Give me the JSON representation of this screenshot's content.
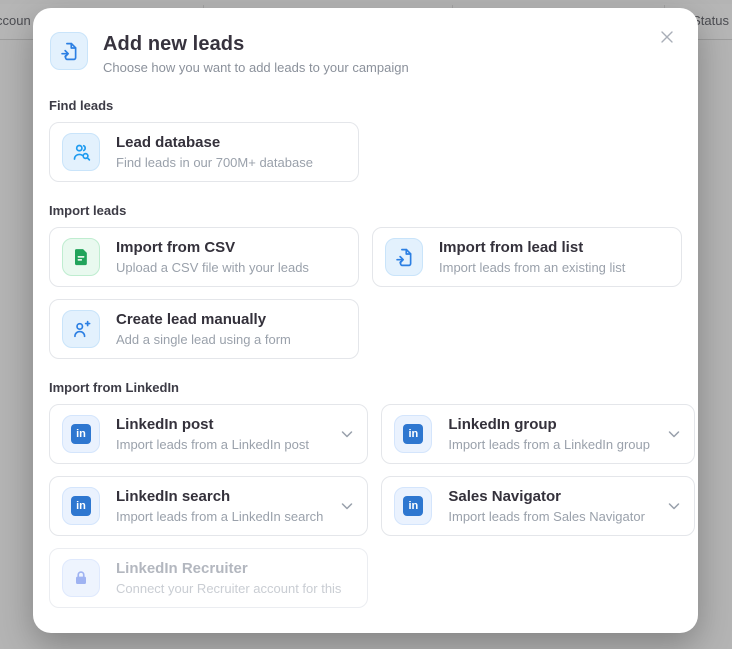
{
  "background": {
    "header_left": "ccoun",
    "header_right": "Status"
  },
  "modal": {
    "title": "Add new leads",
    "subtitle": "Choose how you want to add leads to your campaign",
    "linkedin_badge": "in",
    "sections": [
      {
        "label": "Find leads",
        "cards": [
          {
            "title": "Lead database",
            "subtitle": "Find leads in our 700M+ database",
            "icon": "users-search-icon"
          }
        ]
      },
      {
        "label": "Import leads",
        "cards": [
          {
            "title": "Import from CSV",
            "subtitle": "Upload a CSV file with your leads",
            "icon": "csv-file-icon"
          },
          {
            "title": "Import from lead list",
            "subtitle": "Import leads from an existing list",
            "icon": "document-import-icon"
          },
          {
            "title": "Create lead manually",
            "subtitle": "Add a single lead using a form",
            "icon": "user-plus-icon"
          }
        ]
      },
      {
        "label": "Import from LinkedIn",
        "cards": [
          {
            "title": "LinkedIn post",
            "subtitle": "Import leads from a LinkedIn post",
            "icon": "linkedin-icon",
            "expandable": true
          },
          {
            "title": "LinkedIn group",
            "subtitle": "Import leads from a LinkedIn group",
            "icon": "linkedin-icon",
            "expandable": true
          },
          {
            "title": "LinkedIn search",
            "subtitle": "Import leads from a LinkedIn search",
            "icon": "linkedin-icon",
            "expandable": true
          },
          {
            "title": "Sales Navigator",
            "subtitle": "Import leads from Sales Navigator",
            "icon": "linkedin-icon",
            "expandable": true
          },
          {
            "title": "LinkedIn Recruiter",
            "subtitle": "Connect your Recruiter account for this",
            "icon": "lock-icon",
            "disabled": true
          }
        ]
      }
    ]
  },
  "colors": {
    "accent_blue": "#1e9bf0",
    "doc_blue": "#2b7fe3",
    "linkedin_blue": "#2e77d0",
    "csv_green": "#21a35b",
    "lock_lavender": "#9fb3f2",
    "overlay_gray": "#b4b4b4"
  }
}
